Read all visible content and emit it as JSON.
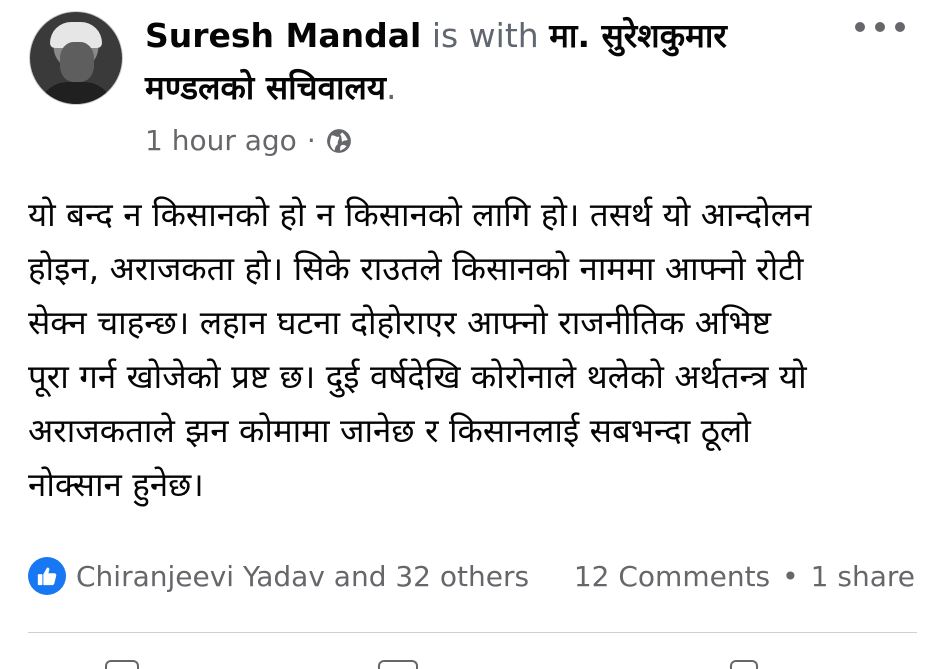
{
  "post": {
    "author": "Suresh Mandal",
    "with_text": " is with ",
    "tagged_line1": "मा. सुरेशकुमार",
    "tagged_line2": "मण्डलको सचिवालय",
    "tagged_period": ".",
    "time": "1 hour ago",
    "separator": "·",
    "privacy_icon": "globe-icon",
    "more_icon": "more-options-icon",
    "body_lines": [
      "यो बन्द न किसानको हो न किसानको लागि हो। तसर्थ यो आन्दोलन",
      "होइन, अराजकता हो। सिके राउतले किसानको नाममा आफ्नो रोटी",
      "सेक्न चाहन्छ। लहान घटना दोहोराएर आफ्नो राजनीतिक अभिष्ट",
      "पूरा गर्न खोजेको प्रष्ट छ। दुई वर्षदेखि कोरोनाले थलेको अर्थतन्त्र यो",
      "अराजकताले झन कोमामा जानेछ र किसानलाई सबभन्दा ठूलो",
      "नोक्सान हुनेछ।"
    ]
  },
  "footer": {
    "reaction_icon": "like-icon",
    "reactions_text": "Chiranjeevi Yadav and 32 others",
    "comments": "12 Comments",
    "dot": "•",
    "shares": "1 share"
  },
  "colors": {
    "accent": "#1877f2",
    "secondary_text": "#65676b",
    "primary_text": "#050505",
    "divider": "#ced0d4"
  }
}
